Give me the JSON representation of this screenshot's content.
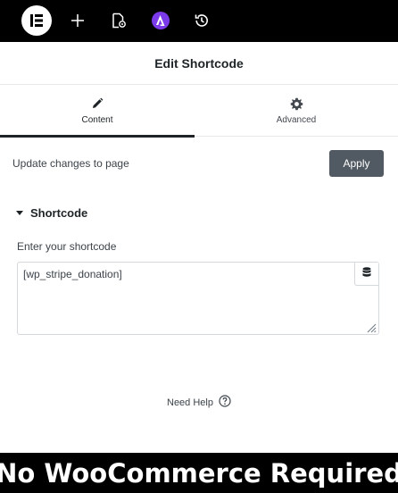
{
  "toolbar": {
    "icons": [
      "elementor-logo-icon",
      "plus-icon",
      "page-settings-icon",
      "astra-icon",
      "history-icon"
    ],
    "accent_color": "#7b3bea"
  },
  "header": {
    "title": "Edit Shortcode"
  },
  "tabs": [
    {
      "label": "Content",
      "icon": "pencil-icon",
      "active": true
    },
    {
      "label": "Advanced",
      "icon": "gear-icon",
      "active": false
    }
  ],
  "update": {
    "text": "Update changes to page",
    "apply_label": "Apply"
  },
  "section": {
    "title": "Shortcode",
    "field_label": "Enter your shortcode",
    "field_value": "[wp_stripe_donation]"
  },
  "help": {
    "label": "Need Help"
  },
  "banner": {
    "text": "No WooCommerce Required"
  }
}
